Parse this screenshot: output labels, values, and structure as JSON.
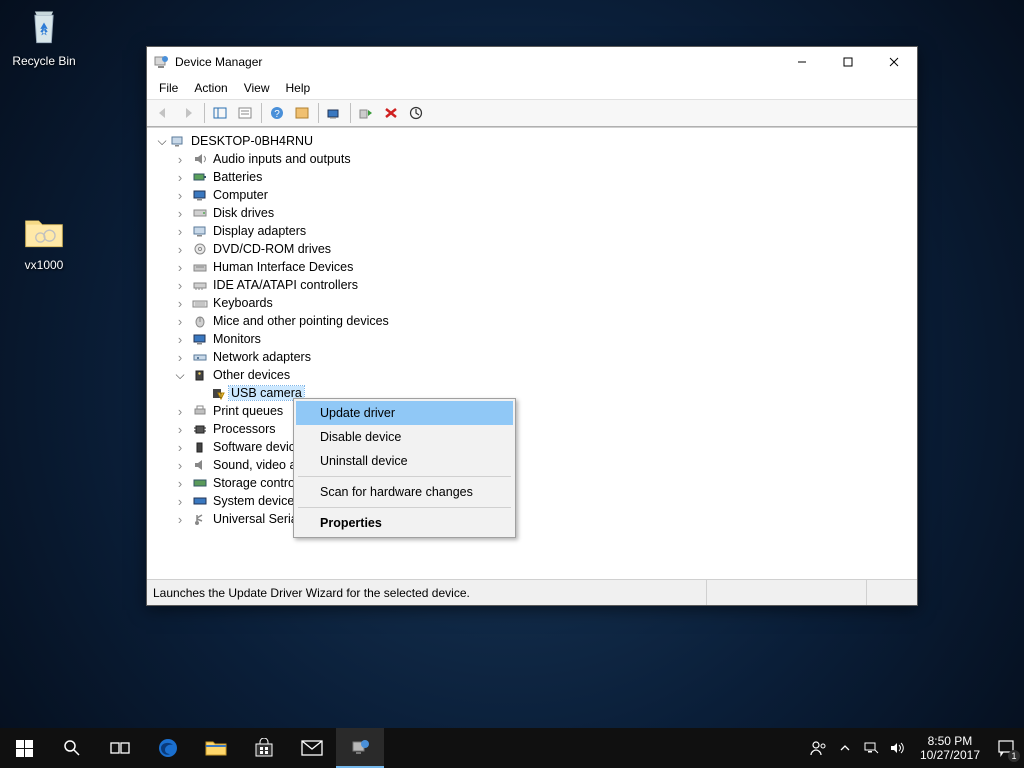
{
  "desktop": {
    "recycle_bin": "Recycle Bin",
    "folder1": "vx1000"
  },
  "window": {
    "title": "Device Manager",
    "menus": {
      "file": "File",
      "action": "Action",
      "view": "View",
      "help": "Help"
    },
    "root": "DESKTOP-0BH4RNU",
    "categories": [
      "Audio inputs and outputs",
      "Batteries",
      "Computer",
      "Disk drives",
      "Display adapters",
      "DVD/CD-ROM drives",
      "Human Interface Devices",
      "IDE ATA/ATAPI controllers",
      "Keyboards",
      "Mice and other pointing devices",
      "Monitors",
      "Network adapters",
      "Other devices",
      "Print queues",
      "Processors",
      "Software devices",
      "Sound, video and game controllers",
      "Storage controllers",
      "System devices",
      "Universal Serial Bus controllers"
    ],
    "other_device_child": "USB camera",
    "status": "Launches the Update Driver Wizard for the selected device."
  },
  "context_menu": {
    "update": "Update driver",
    "disable": "Disable device",
    "uninstall": "Uninstall device",
    "scan": "Scan for hardware changes",
    "properties": "Properties"
  },
  "tray": {
    "time": "8:50 PM",
    "date": "10/27/2017",
    "badge": "1"
  }
}
